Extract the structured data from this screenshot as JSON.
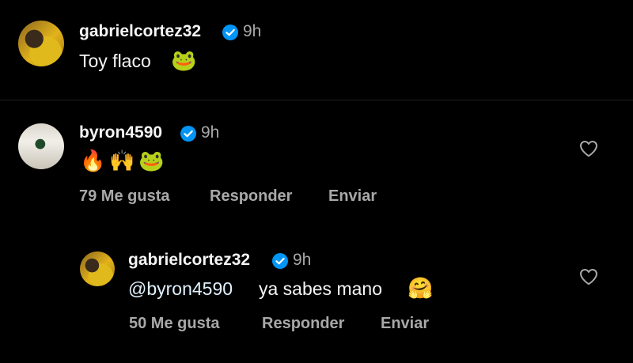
{
  "caption": {
    "username": "gabrielcortez32",
    "time": "9h",
    "text": "Toy flaco",
    "emoji": "🐸",
    "verified": true
  },
  "comment": {
    "username": "byron4590",
    "time": "9h",
    "emojis": [
      "🔥",
      "🙌",
      "🐸"
    ],
    "likes": "79 Me gusta",
    "reply_label": "Responder",
    "send_label": "Enviar",
    "verified": true
  },
  "reply": {
    "username": "gabrielcortez32",
    "time": "9h",
    "mention": "@byron4590",
    "text": "ya sabes mano",
    "emoji": "🤗",
    "likes": "50 Me gusta",
    "reply_label": "Responder",
    "send_label": "Enviar",
    "verified": true
  },
  "colors": {
    "background": "#000000",
    "primary_text": "#f5f5f5",
    "secondary_text": "#a8a8a8",
    "verified_badge": "#0095f6",
    "mention": "#e0f1ff"
  }
}
